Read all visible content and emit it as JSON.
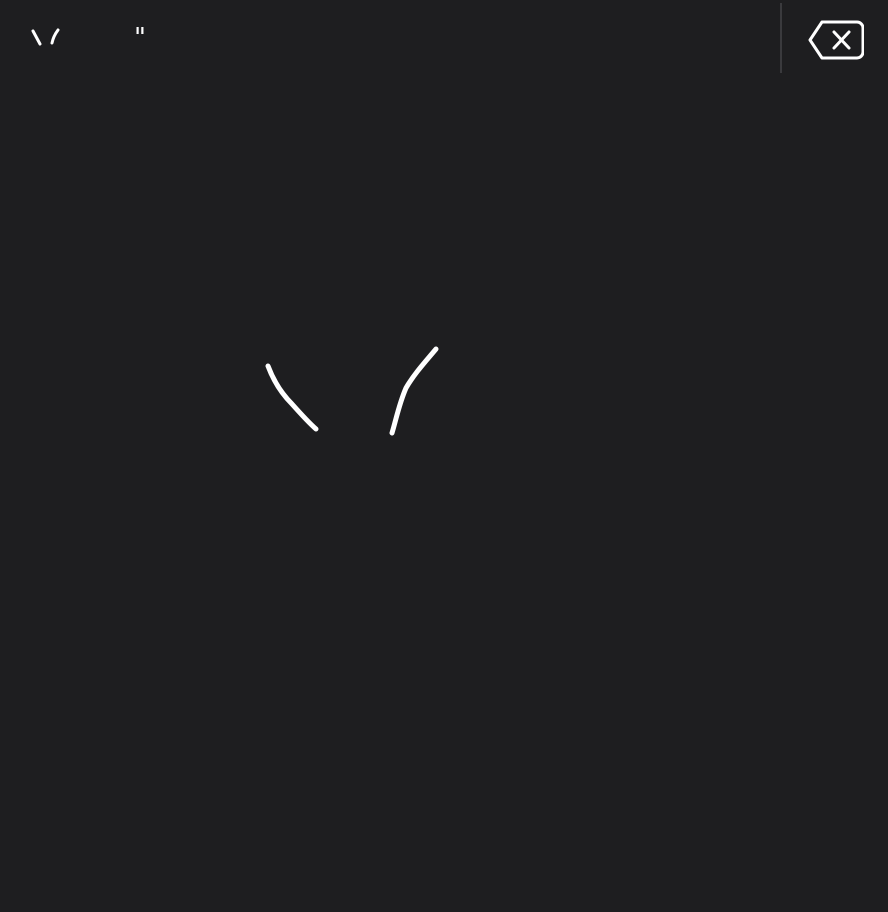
{
  "candidates": [
    {
      "label": "\\/",
      "icon": "handwriting-candidate-vee"
    },
    {
      "label": "\"",
      "icon": "handwriting-candidate-quote"
    }
  ],
  "delete_button": {
    "icon": "backspace-icon"
  },
  "handwriting_canvas": {
    "stroke_color": "#ffffff",
    "background": "#1e1e20"
  },
  "colors": {
    "background": "#1e1e20",
    "divider": "#3a3a3d",
    "foreground": "#ffffff"
  }
}
